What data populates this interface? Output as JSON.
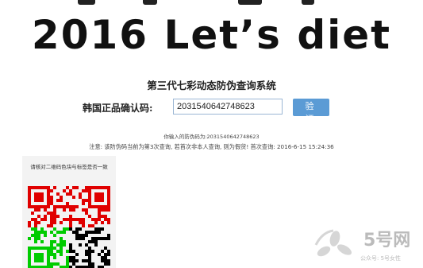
{
  "banner": {
    "title": "2016 Let’s diet"
  },
  "system": {
    "title": "第三代七彩动态防伪查询系统"
  },
  "verify": {
    "label": "韩国正品确认码:",
    "code": "2031540642748623",
    "button_label": "验 证"
  },
  "result": {
    "entered_prefix": "你输入的防伪码为:",
    "entered_code": "2031540642748623",
    "note": "注意: 该防伪码当前为第3次查询, 若首次非本人查询, 则为假货! 首次查询: 2016-6-15 15:24:36"
  },
  "qr_panel": {
    "caption": "请核对二维码色块与标签是否一致",
    "quadrant_colors": [
      "#e00000",
      "#e00000",
      "#00cc00",
      "#000000"
    ]
  },
  "watermark": {
    "brand": "5号网",
    "sub": "公众号: 5号女性",
    "color": "#bbbbbb"
  }
}
